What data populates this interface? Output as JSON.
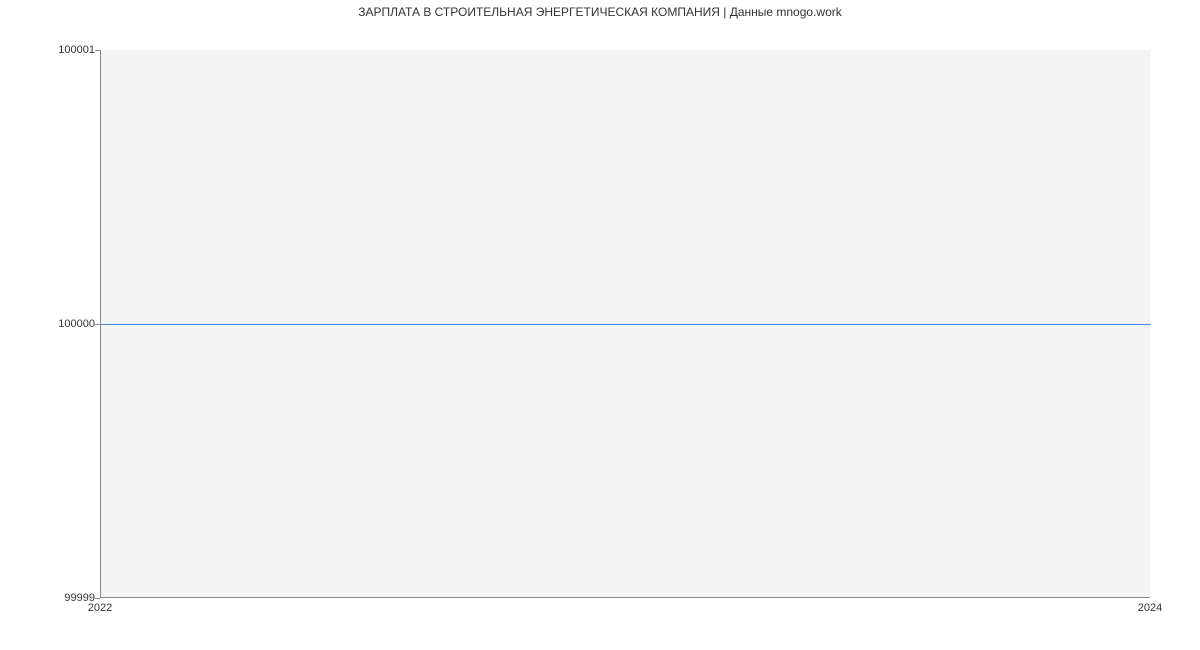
{
  "chart_data": {
    "type": "line",
    "title": "ЗАРПЛАТА В  СТРОИТЕЛЬНАЯ ЭНЕРГЕТИЧЕСКАЯ КОМПАНИЯ | Данные mnogo.work",
    "x": [
      2022,
      2024
    ],
    "y": [
      100000,
      100000
    ],
    "xlabel": "",
    "ylabel": "",
    "xlim": [
      2022,
      2024
    ],
    "ylim": [
      99999,
      100001
    ],
    "x_ticks": [
      2022,
      2024
    ],
    "y_ticks": [
      99999,
      100000,
      100001
    ],
    "line_color": "#4a86e8"
  }
}
